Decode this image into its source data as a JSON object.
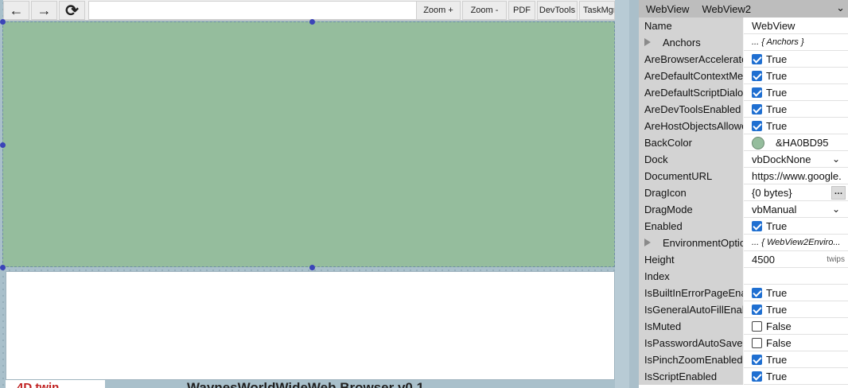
{
  "toolbar": {
    "back_icon": "←",
    "forward_icon": "→",
    "refresh_icon": "⟳",
    "address_value": "",
    "zoom_in": "Zoom +",
    "zoom_out": "Zoom -",
    "pdf": "PDF",
    "devtools": "DevTools",
    "taskmgr": "TaskMgr"
  },
  "form": {
    "title_partial": "WaynesWorldWideWeb Browser v0.1",
    "logo_partial": "4D  twin"
  },
  "props": {
    "object_name": "WebView",
    "object_type": "WebView2",
    "rows": [
      {
        "name": "Name",
        "value": "WebView"
      },
      {
        "name": "Anchors",
        "value": "... { Anchors }"
      },
      {
        "name": "AreBrowserAcceleratorKeysEnabled",
        "value": "True"
      },
      {
        "name": "AreDefaultContextMenusEnabled",
        "value": "True"
      },
      {
        "name": "AreDefaultScriptDialogsEnabled",
        "value": "True"
      },
      {
        "name": "AreDevToolsEnabled",
        "value": "True"
      },
      {
        "name": "AreHostObjectsAllowed",
        "value": "True"
      },
      {
        "name": "BackColor",
        "value": "&HA0BD95"
      },
      {
        "name": "Dock",
        "value": "vbDockNone"
      },
      {
        "name": "DocumentURL",
        "value": "https://www.google."
      },
      {
        "name": "DragIcon",
        "value": "{0 bytes}"
      },
      {
        "name": "DragMode",
        "value": "vbManual"
      },
      {
        "name": "Enabled",
        "value": "True"
      },
      {
        "name": "EnvironmentOptions",
        "value": "... { WebView2Enviro..."
      },
      {
        "name": "Height",
        "value": "4500",
        "unit": "twips"
      },
      {
        "name": "Index",
        "value": ""
      },
      {
        "name": "IsBuiltInErrorPageEnabled",
        "value": "True"
      },
      {
        "name": "IsGeneralAutoFillEnabled",
        "value": "True"
      },
      {
        "name": "IsMuted",
        "value": "False"
      },
      {
        "name": "IsPasswordAutoSaveEnabled",
        "value": "False"
      },
      {
        "name": "IsPinchZoomEnabled",
        "value": "True"
      },
      {
        "name": "IsScriptEnabled",
        "value": "True"
      }
    ]
  },
  "colors": {
    "webview_back": "#95bd9d",
    "handle": "#3b44b8",
    "checkbox": "#1f6fd1"
  }
}
